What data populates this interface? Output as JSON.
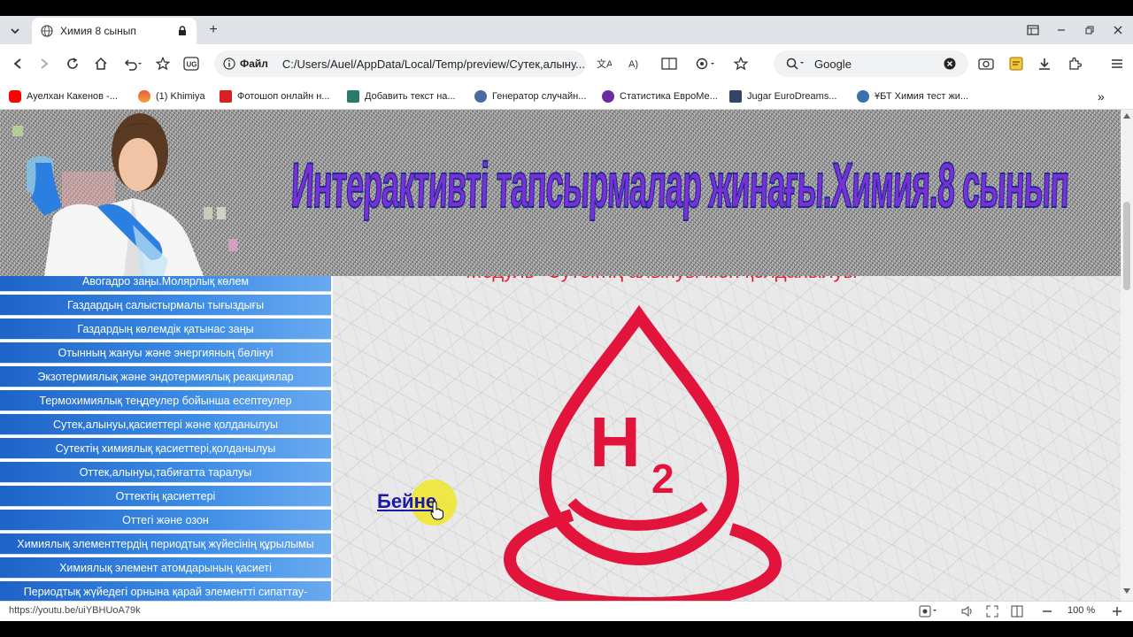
{
  "browser": {
    "tab_title": "Химия 8 сынып",
    "new_tab_label": "+",
    "address": {
      "info_label": "Файл",
      "url": "C:/Users/Auel/AppData/Local/Temp/preview/Сутек,алыну..."
    },
    "search": {
      "engine": "Google"
    },
    "bookmarks": [
      {
        "label": "Ауелхан Какенов -...",
        "icon": "youtube-icon",
        "color": "#ff0000"
      },
      {
        "label": "(1) Khimiya",
        "icon": "stack-icon",
        "color": "#e65a3c"
      },
      {
        "label": "Фотошоп онлайн н...",
        "icon": "photoshop-icon",
        "color": "#d82020"
      },
      {
        "label": "Добавить текст на...",
        "icon": "text-icon",
        "color": "#2a7a6a"
      },
      {
        "label": "Генератор случайн...",
        "icon": "globe-icon",
        "color": "#4a6aa0"
      },
      {
        "label": "Статистика ЕвроМе...",
        "icon": "circle-icon",
        "color": "#6a2aa0"
      },
      {
        "label": "Jugar EuroDreams...",
        "icon": "page-icon",
        "color": "#334466"
      },
      {
        "label": "ҰБТ Химия тест жи...",
        "icon": "wordpress-icon",
        "color": "#3a6fb0"
      }
    ],
    "status_url": "https://youtu.be/uiYBHUoA79k",
    "zoom": "100 %"
  },
  "page": {
    "header_title": "Интерактивті тапсырмалар жинағы.Химия.8 сынып",
    "module_title": "Модуль \"Сутектің алынуы мен қолданылуы\"",
    "video_link": "Бейне",
    "menu": [
      "Авогадро заңы.Молярлық көлем",
      "Газдардың салыстырмалы тығыздығы",
      "Газдардың көлемдік қатынас заңы",
      "Отынның жануы және энергияның  бөлінуі",
      "Экзотермиялық және эндотермиялық реакциялар",
      "Термохимиялық теңдеулер бойынша есептеулер",
      "Сутек,алынуы,қасиеттері және қолданылуы",
      "Сутектің химиялық қасиеттері,қолданылуы",
      "Оттек,алынуы,табиғатта таралуы",
      "Оттектің қасиеттері",
      "Оттегі және озон",
      "Химиялық элементтердің периодтық жүйесінің құрылымы",
      "Химиялық элемент атомдарының қасиеті",
      "Периодтық жүйедегі орнына қарай элементті сипаттау-"
    ],
    "h2_symbol": "H",
    "h2_subscript": "2",
    "accent_red": "#e3143c"
  }
}
